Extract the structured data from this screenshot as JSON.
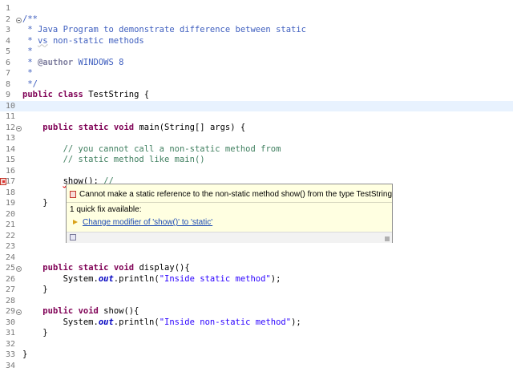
{
  "editor": {
    "lines": [
      {
        "n": "1",
        "fold": false,
        "error": false,
        "current": false,
        "tokens": []
      },
      {
        "n": "2",
        "fold": true,
        "error": false,
        "current": false,
        "tokens": [
          {
            "t": "jdoc",
            "s": "/**"
          }
        ]
      },
      {
        "n": "3",
        "fold": false,
        "error": false,
        "current": false,
        "tokens": [
          {
            "t": "jdoc",
            "s": " * Java Program to demonstrate difference between static"
          }
        ]
      },
      {
        "n": "4",
        "fold": false,
        "error": false,
        "current": false,
        "tokens": [
          {
            "t": "jdoc",
            "s": " * "
          },
          {
            "t": "jdoc-squig",
            "s": "vs"
          },
          {
            "t": "jdoc",
            "s": " non-static methods"
          }
        ]
      },
      {
        "n": "5",
        "fold": false,
        "error": false,
        "current": false,
        "tokens": [
          {
            "t": "jdoc",
            "s": " *"
          }
        ]
      },
      {
        "n": "6",
        "fold": false,
        "error": false,
        "current": false,
        "tokens": [
          {
            "t": "jdoc",
            "s": " * "
          },
          {
            "t": "tag",
            "s": "@author"
          },
          {
            "t": "jdoc",
            "s": " WINDOWS 8"
          }
        ]
      },
      {
        "n": "7",
        "fold": false,
        "error": false,
        "current": false,
        "tokens": [
          {
            "t": "jdoc",
            "s": " *"
          }
        ]
      },
      {
        "n": "8",
        "fold": false,
        "error": false,
        "current": false,
        "tokens": [
          {
            "t": "jdoc",
            "s": " */"
          }
        ]
      },
      {
        "n": "9",
        "fold": false,
        "error": false,
        "current": false,
        "tokens": [
          {
            "t": "kw",
            "s": "public"
          },
          {
            "t": "plain",
            "s": " "
          },
          {
            "t": "kw",
            "s": "class"
          },
          {
            "t": "plain",
            "s": " TestString {"
          }
        ]
      },
      {
        "n": "10",
        "fold": false,
        "error": false,
        "current": true,
        "tokens": []
      },
      {
        "n": "11",
        "fold": false,
        "error": false,
        "current": false,
        "tokens": []
      },
      {
        "n": "12",
        "fold": true,
        "error": false,
        "current": false,
        "tokens": [
          {
            "t": "plain",
            "s": "    "
          },
          {
            "t": "kw",
            "s": "public"
          },
          {
            "t": "plain",
            "s": " "
          },
          {
            "t": "kw",
            "s": "static"
          },
          {
            "t": "plain",
            "s": " "
          },
          {
            "t": "kw",
            "s": "void"
          },
          {
            "t": "plain",
            "s": " main(String[] args) {"
          }
        ]
      },
      {
        "n": "13",
        "fold": false,
        "error": false,
        "current": false,
        "tokens": []
      },
      {
        "n": "14",
        "fold": false,
        "error": false,
        "current": false,
        "tokens": [
          {
            "t": "plain",
            "s": "        "
          },
          {
            "t": "cmt",
            "s": "// you cannot call a non-static method from"
          }
        ]
      },
      {
        "n": "15",
        "fold": false,
        "error": false,
        "current": false,
        "tokens": [
          {
            "t": "plain",
            "s": "        "
          },
          {
            "t": "cmt",
            "s": "// static method like main()"
          }
        ]
      },
      {
        "n": "16",
        "fold": false,
        "error": false,
        "current": false,
        "tokens": []
      },
      {
        "n": "17",
        "fold": false,
        "error": true,
        "current": false,
        "tokens": [
          {
            "t": "plain",
            "s": "        "
          },
          {
            "t": "err",
            "s": "show"
          },
          {
            "t": "plain",
            "s": "(); "
          },
          {
            "t": "cmt",
            "s": "//"
          }
        ]
      },
      {
        "n": "18",
        "fold": false,
        "error": false,
        "current": false,
        "tokens": []
      },
      {
        "n": "19",
        "fold": false,
        "error": false,
        "current": false,
        "tokens": [
          {
            "t": "plain",
            "s": "    }"
          }
        ]
      },
      {
        "n": "20",
        "fold": false,
        "error": false,
        "current": false,
        "tokens": []
      },
      {
        "n": "21",
        "fold": false,
        "error": false,
        "current": false,
        "tokens": []
      },
      {
        "n": "22",
        "fold": false,
        "error": false,
        "current": false,
        "tokens": []
      },
      {
        "n": "23",
        "fold": false,
        "error": false,
        "current": false,
        "tokens": []
      },
      {
        "n": "24",
        "fold": false,
        "error": false,
        "current": false,
        "tokens": []
      },
      {
        "n": "25",
        "fold": true,
        "error": false,
        "current": false,
        "tokens": [
          {
            "t": "plain",
            "s": "    "
          },
          {
            "t": "kw",
            "s": "public"
          },
          {
            "t": "plain",
            "s": " "
          },
          {
            "t": "kw",
            "s": "static"
          },
          {
            "t": "plain",
            "s": " "
          },
          {
            "t": "kw",
            "s": "void"
          },
          {
            "t": "plain",
            "s": " display(){"
          }
        ]
      },
      {
        "n": "26",
        "fold": false,
        "error": false,
        "current": false,
        "tokens": [
          {
            "t": "plain",
            "s": "        System."
          },
          {
            "t": "fld",
            "s": "out"
          },
          {
            "t": "plain",
            "s": ".println("
          },
          {
            "t": "str",
            "s": "\"Inside static method\""
          },
          {
            "t": "plain",
            "s": ");"
          }
        ]
      },
      {
        "n": "27",
        "fold": false,
        "error": false,
        "current": false,
        "tokens": [
          {
            "t": "plain",
            "s": "    }"
          }
        ]
      },
      {
        "n": "28",
        "fold": false,
        "error": false,
        "current": false,
        "tokens": []
      },
      {
        "n": "29",
        "fold": true,
        "error": false,
        "current": false,
        "tokens": [
          {
            "t": "plain",
            "s": "    "
          },
          {
            "t": "kw",
            "s": "public"
          },
          {
            "t": "plain",
            "s": " "
          },
          {
            "t": "kw",
            "s": "void"
          },
          {
            "t": "plain",
            "s": " show(){"
          }
        ]
      },
      {
        "n": "30",
        "fold": false,
        "error": false,
        "current": false,
        "tokens": [
          {
            "t": "plain",
            "s": "        System."
          },
          {
            "t": "fld",
            "s": "out"
          },
          {
            "t": "plain",
            "s": ".println("
          },
          {
            "t": "str",
            "s": "\"Inside non-static method\""
          },
          {
            "t": "plain",
            "s": ");"
          }
        ]
      },
      {
        "n": "31",
        "fold": false,
        "error": false,
        "current": false,
        "tokens": [
          {
            "t": "plain",
            "s": "    }"
          }
        ]
      },
      {
        "n": "32",
        "fold": false,
        "error": false,
        "current": false,
        "tokens": []
      },
      {
        "n": "33",
        "fold": false,
        "error": false,
        "current": false,
        "tokens": [
          {
            "t": "plain",
            "s": "}"
          }
        ]
      },
      {
        "n": "34",
        "fold": false,
        "error": false,
        "current": false,
        "tokens": []
      }
    ]
  },
  "hover": {
    "message": "Cannot make a static reference to the non-static method show() from the type TestString",
    "quickfix_count": "1 quick fix available:",
    "fix_label": "Change modifier of 'show()' to 'static'",
    "message_icon": "error-icon",
    "fix_icon": "quickfix-icon",
    "footer_icon": "focus-icon"
  },
  "colors": {
    "keyword": "#7f0055",
    "comment": "#3f7f5f",
    "javadoc": "#3f5fbf",
    "string": "#2a00ff",
    "field": "#0000c0",
    "error": "#e00000",
    "popup_bg": "#ffffe1",
    "current_line": "#e8f2fe"
  }
}
